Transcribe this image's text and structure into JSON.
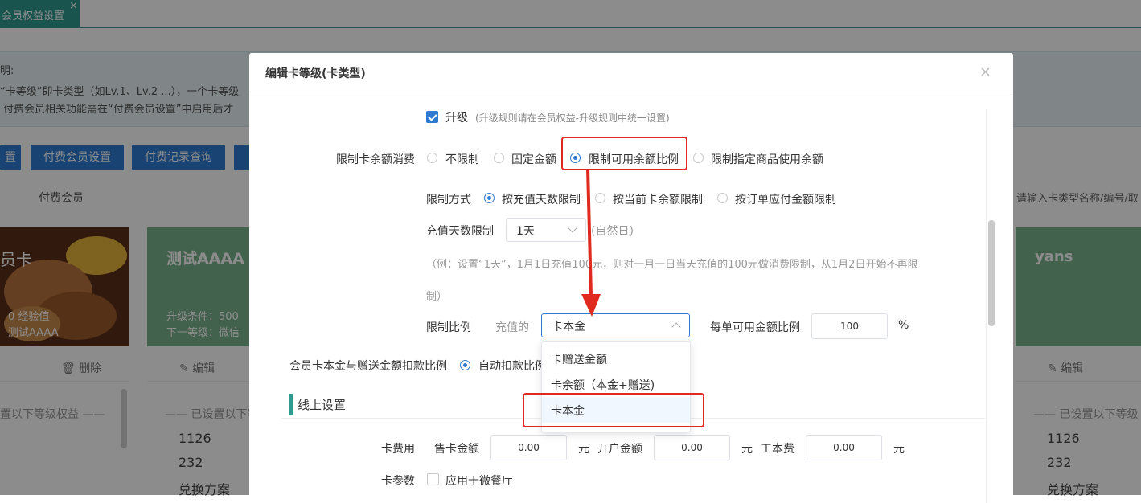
{
  "tab": {
    "label": "会员权益设置",
    "close": "×"
  },
  "notice": {
    "line1": "明:",
    "line2": "“卡等级”即卡类型（如Lv.1、Lv.2 ...），一个卡等级",
    "line3": "付费会员相关功能需在“付费会员设置”中启用后才"
  },
  "bg_buttons": [
    "置",
    "付费会员设置",
    "付费记录查询"
  ],
  "bg_subtab": "付费会员",
  "bg_search_placeholder": "请输入卡类型名称/编号/取",
  "cards": {
    "card1": {
      "title": "员卡",
      "exp": "0 经验值",
      "name": "测试AAAA",
      "footer": "删除"
    },
    "card2": {
      "title": "测试AAAA",
      "upgrade": "升级条件：500",
      "next": "下一等级：微信",
      "footer": "编辑"
    },
    "card3": {
      "title": "yans",
      "footer": "编辑"
    }
  },
  "bg_levels": {
    "left": "置以下等级权益 ——",
    "mid": "—— 已设置以下等",
    "right": "—— 已设置以下等级",
    "mid_values": [
      "1126",
      "232",
      "兑换方案"
    ],
    "right_values": [
      "1126",
      "232",
      "兑换方案"
    ]
  },
  "modal": {
    "title": "编辑卡等级(卡类型)",
    "close": "×",
    "upgrade": {
      "label": "升级",
      "hint": "(升级规则请在会员权益-升级规则中统一设置)",
      "checked": true
    },
    "balance_limit": {
      "label": "限制卡余额消费",
      "options": [
        "不限制",
        "固定金额",
        "限制可用余额比例",
        "限制指定商品使用余额"
      ],
      "selected": "限制可用余额比例"
    },
    "limit_mode": {
      "label": "限制方式",
      "options": [
        "按充值天数限制",
        "按当前卡余额限制",
        "按订单应付金额限制"
      ],
      "selected": "按充值天数限制"
    },
    "recharge_days": {
      "label": "充值天数限制",
      "value": "1天",
      "suffix": "(自然日)"
    },
    "example": {
      "line1": "（例：设置“1天”，1月1日充值100元，则对一月一日当天充值的100元做消费限制，从1月2日开始不再限",
      "line2": "制）"
    },
    "ratio": {
      "label": "限制比例",
      "prefix": "充值的",
      "select_value": "卡本金",
      "per_order_label": "每单可用金额比例",
      "per_order_value": "100",
      "unit": "%"
    },
    "deduct": {
      "label": "会员卡本金与赠送金额扣款比例",
      "option": "自动扣款比例"
    },
    "online_section": "线上设置",
    "fees": {
      "label": "卡费用",
      "sell_label": "售卡金额",
      "sell_value": "0.00",
      "open_label": "开户金额",
      "open_value": "0.00",
      "cost_label": "工本费",
      "cost_value": "0.00",
      "unit": "元"
    },
    "params": {
      "label": "卡参数",
      "option": "应用于微餐厅"
    }
  },
  "dropdown": {
    "options": [
      "卡赠送金额",
      "卡余额（本金+赠送)",
      "卡本金"
    ],
    "highlighted": "卡本金"
  },
  "annotation_color": "#e02a1f",
  "accent_color": "#2f7ad1"
}
